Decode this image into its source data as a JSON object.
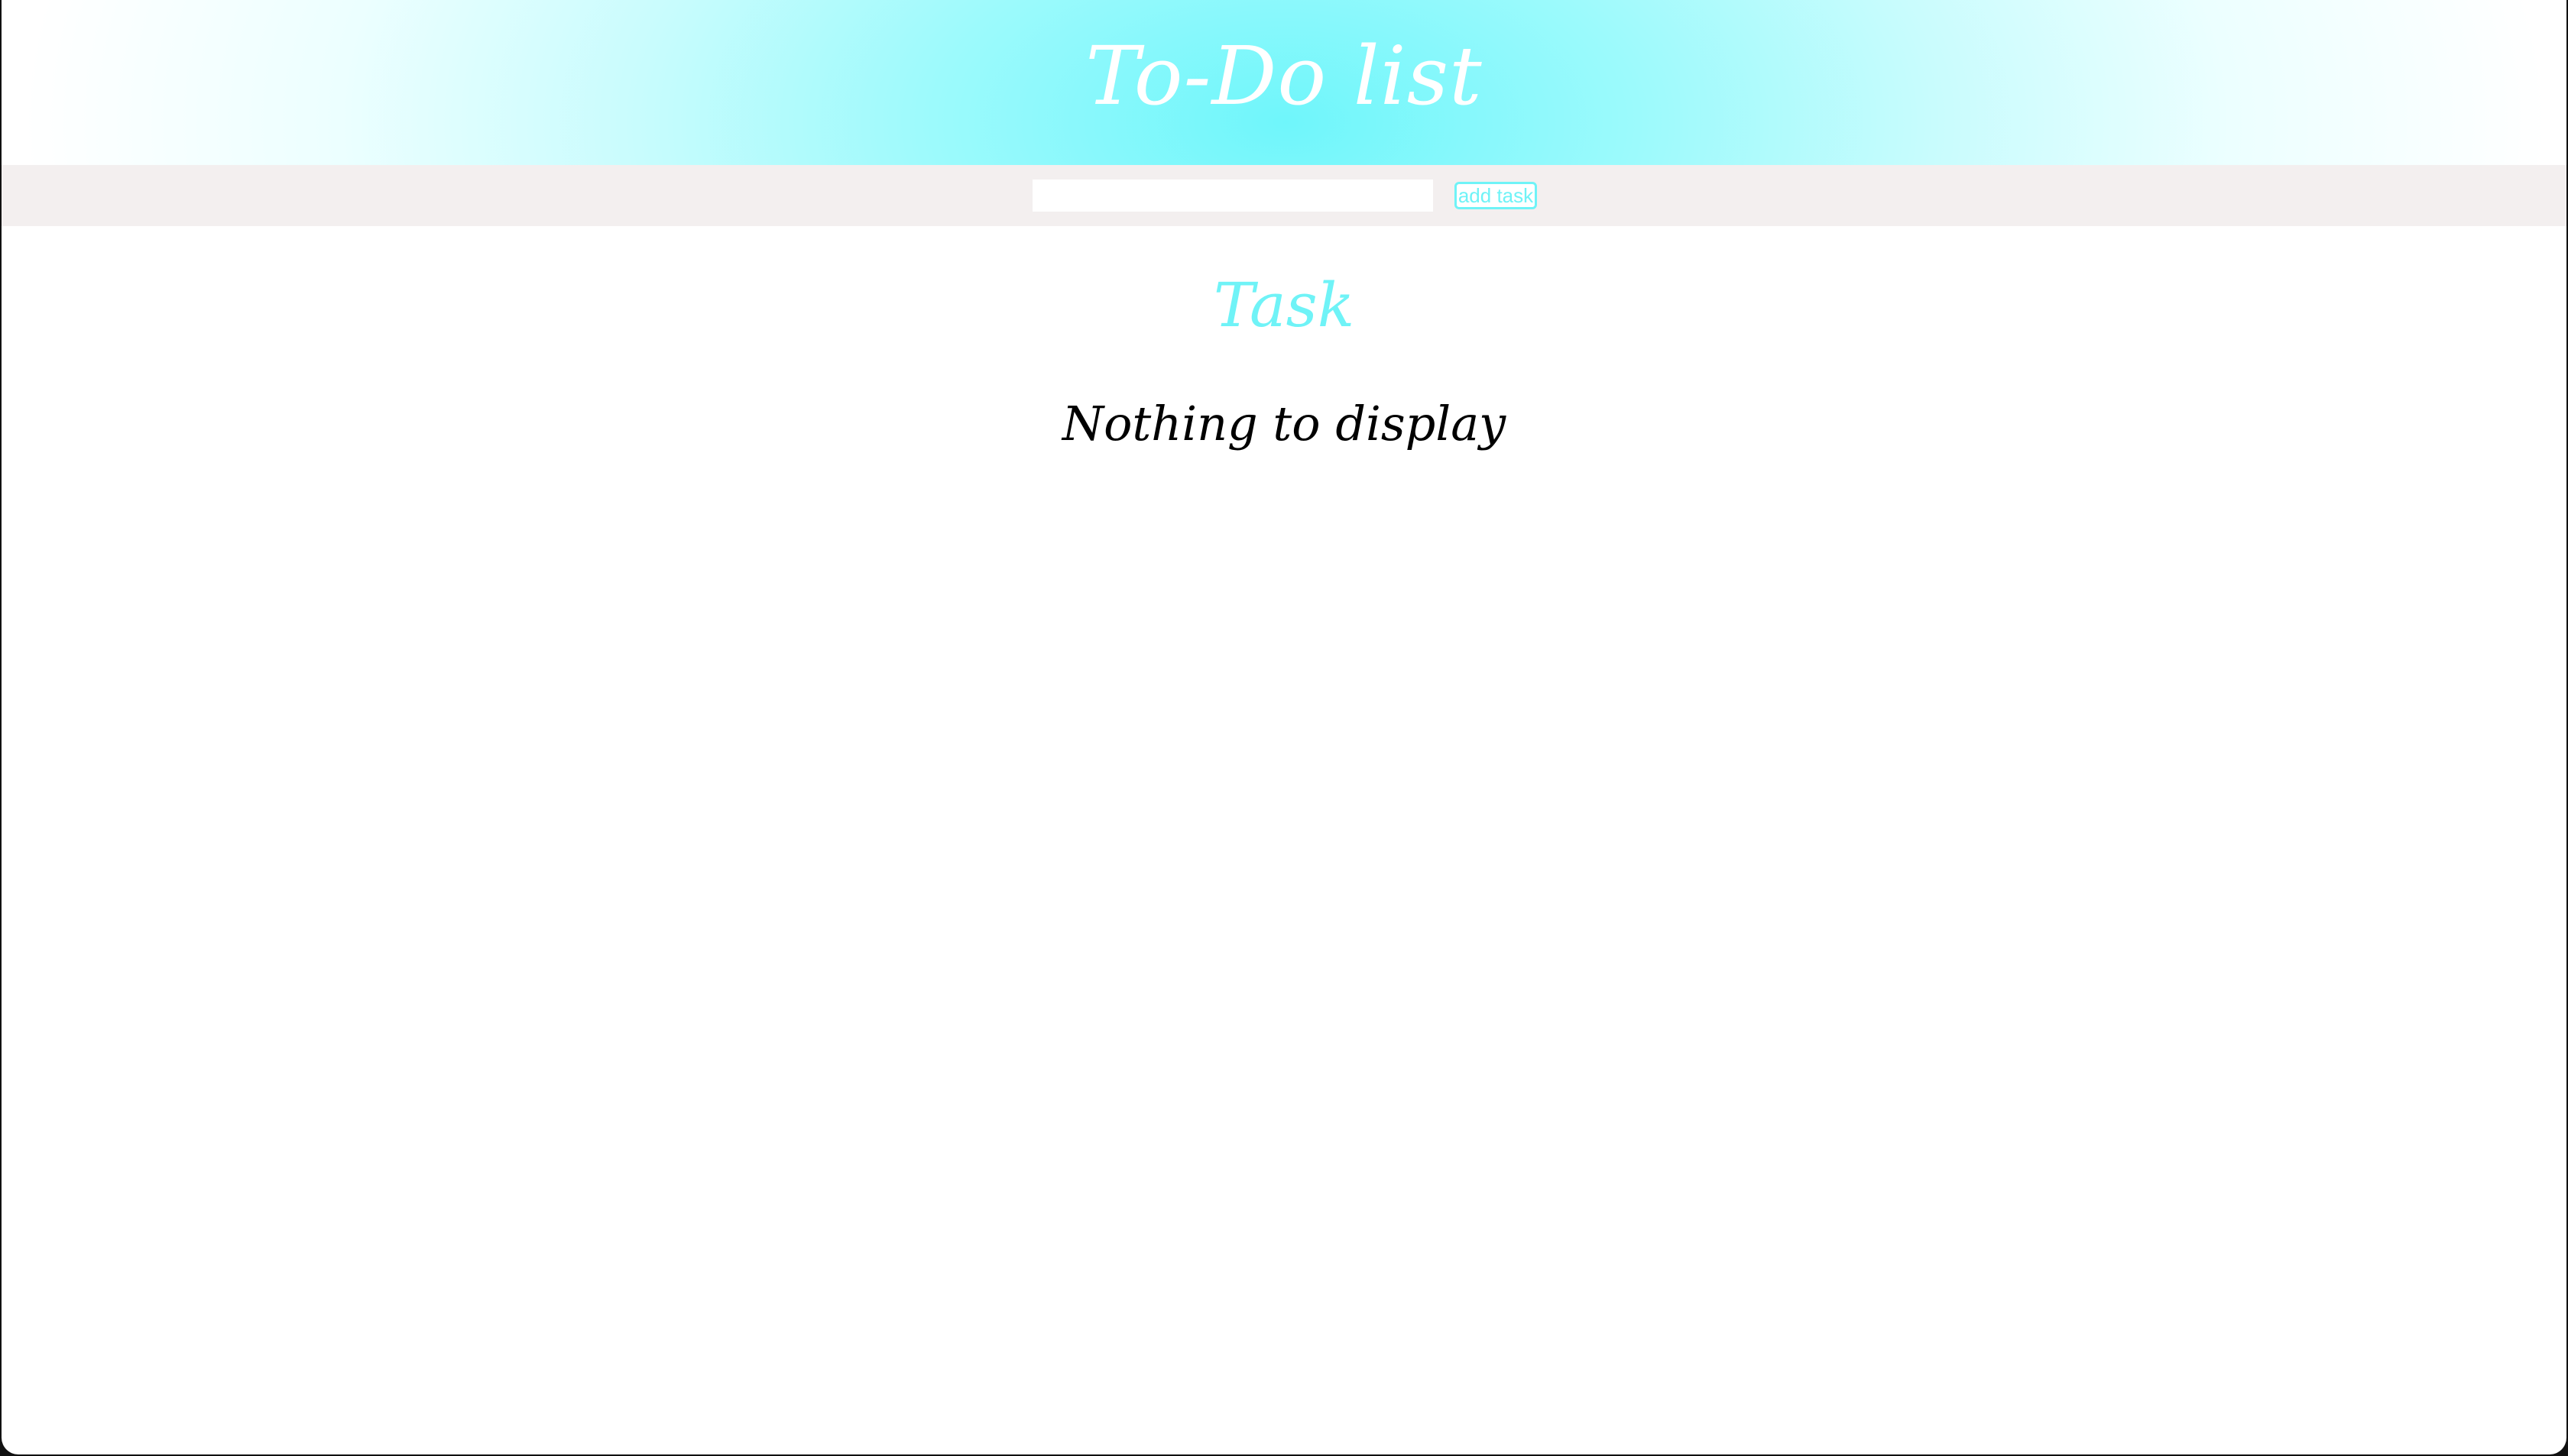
{
  "header": {
    "title": "To-Do list"
  },
  "toolbar": {
    "input_value": "",
    "add_label": "add task"
  },
  "tasks_section": {
    "heading": "Task",
    "empty_message": "Nothing to display"
  },
  "colors": {
    "accent": "#6ff3f7",
    "toolbar_background": "#f3efef",
    "text": "#000000"
  }
}
